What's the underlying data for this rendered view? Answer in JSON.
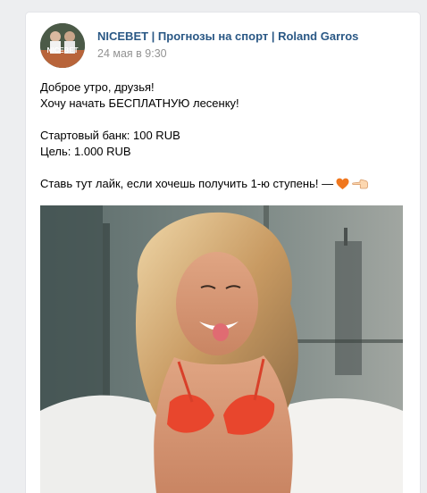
{
  "post": {
    "author": "NICEBET | Прогнозы на спорт | Roland Garros",
    "date": "24 мая в 9:30",
    "avatar_text": "NICEBET",
    "text_lines": [
      "Доброе утро, друзья!",
      "Хочу начать БЕСПЛАТНУЮ лесенку!",
      "",
      "Стартовый банк: 100 RUB",
      "Цель: 1.000 RUB",
      "",
      "Ставь тут лайк, если хочешь получить 1-ю ступень! —"
    ],
    "emoji": [
      "orange-heart-icon",
      "pointing-left-hand-icon"
    ]
  },
  "colors": {
    "link": "#2a5885",
    "date": "#939393",
    "background": "#edeef0"
  }
}
